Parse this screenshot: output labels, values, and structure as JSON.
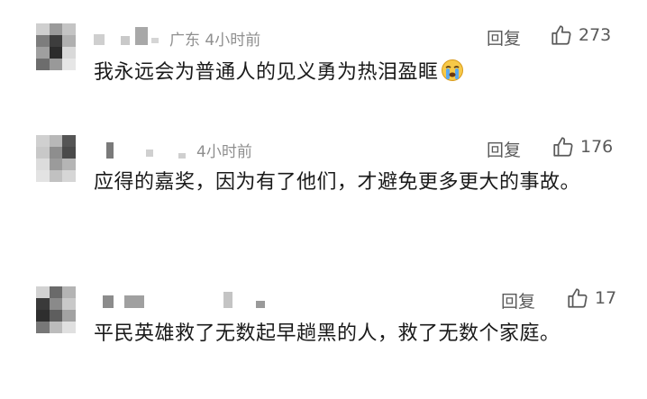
{
  "comments": [
    {
      "location_time": "广东 4小时前",
      "reply_label": "回复",
      "likes": "273",
      "text": "我永远会为普通人的见义勇为热泪盈眶",
      "emoji": "crying-face"
    },
    {
      "location_time": "4小时前",
      "reply_label": "回复",
      "likes": "176",
      "text": "应得的嘉奖，因为有了他们，才避免更多更大的事故。"
    },
    {
      "location_time": "",
      "reply_label": "回复",
      "likes": "17",
      "text": "平民英雄救了无数起早趟黑的人，救了无数个家庭。"
    }
  ],
  "colors": {
    "text": "#1a1a1a",
    "meta": "#8f8f8f",
    "action": "#5a5a5a"
  }
}
